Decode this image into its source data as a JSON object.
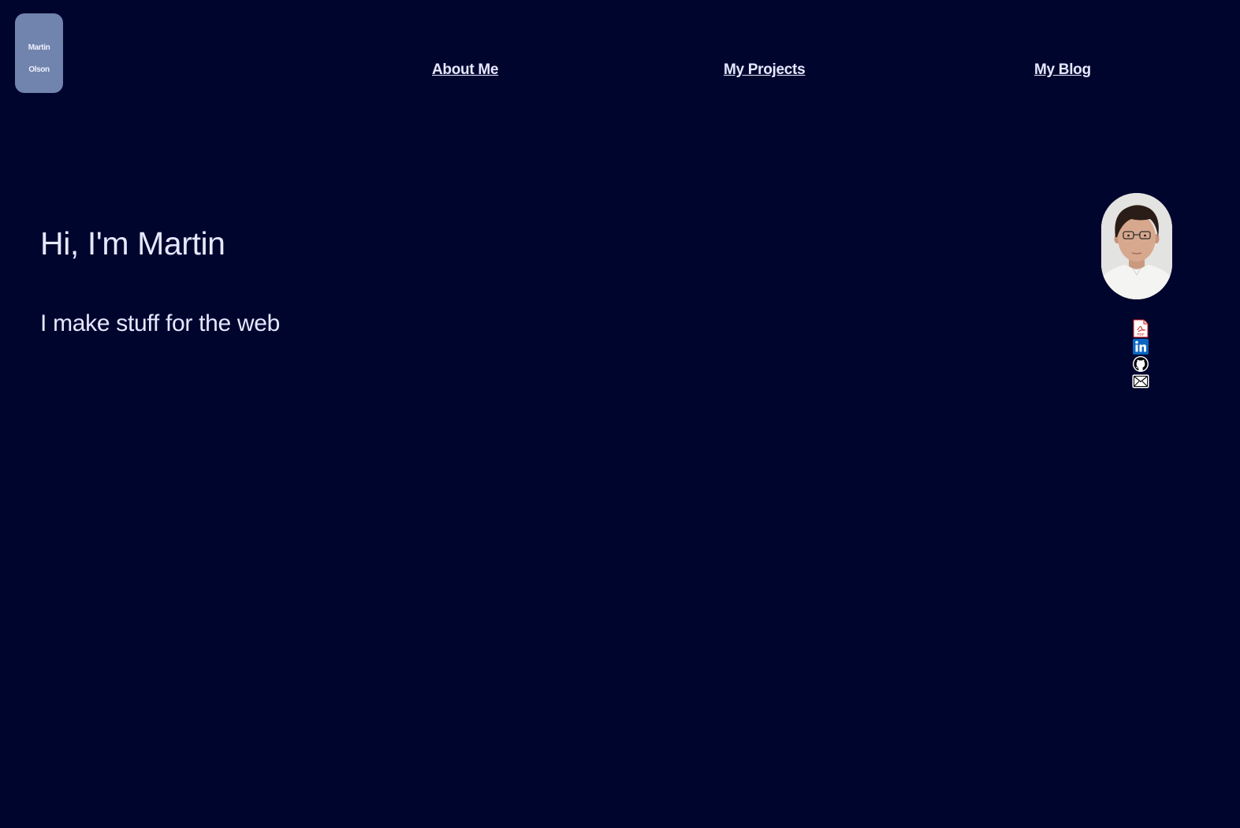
{
  "logo": {
    "first": "Martin",
    "last": "Olson"
  },
  "nav": {
    "about": "About Me",
    "projects": "My Projects",
    "blog": "My Blog"
  },
  "hero": {
    "title": "Hi, I'm Martin",
    "subtitle": "I make stuff for the web"
  },
  "social": {
    "icons": [
      "pdf-icon",
      "linkedin-icon",
      "github-icon",
      "email-icon"
    ],
    "pdf_label": "PDF"
  },
  "colors": {
    "background": "#00052e",
    "logo_bg": "#7184ad",
    "text": "#e6e8ff",
    "linkedin": "#0a66c2",
    "pdf_red": "#d0161b"
  }
}
